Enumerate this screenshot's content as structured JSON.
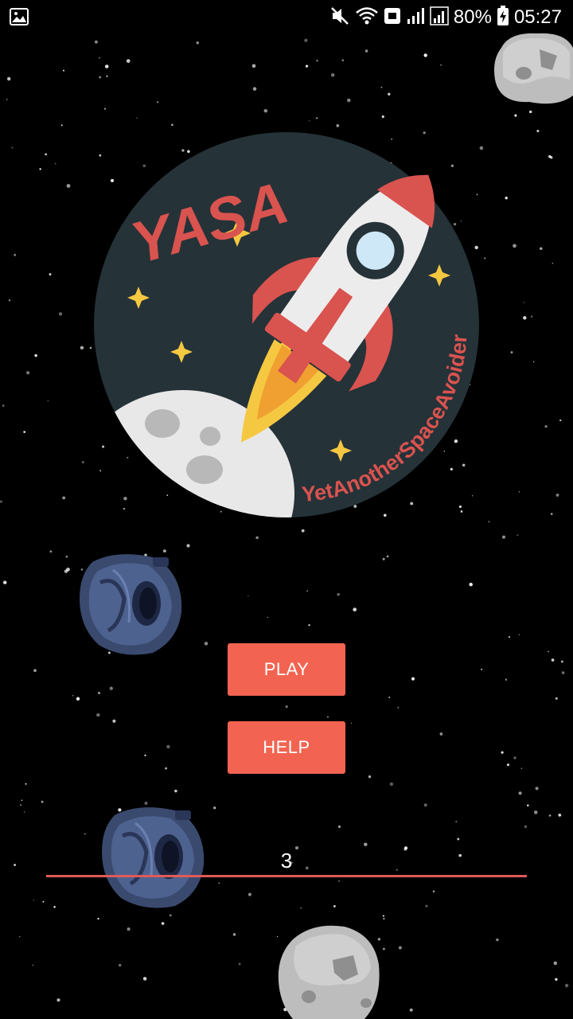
{
  "status_bar": {
    "battery_percent": "80%",
    "time": "05:27",
    "icons": [
      "gallery-icon",
      "mute-icon",
      "wifi-icon",
      "message-icon",
      "signal-icon",
      "signal-icon",
      "battery-charging-icon"
    ]
  },
  "logo": {
    "title": "YASA",
    "subtitle": "YetAnotherSpaceAvoider"
  },
  "menu": {
    "play_label": "PLAY",
    "help_label": "HELP"
  },
  "level_input": {
    "value": "3"
  },
  "colors": {
    "background": "#000000",
    "accent": "#f26451",
    "logo_circle": "#253238",
    "logo_text": "#d9534f",
    "moon": "#e6e6e6",
    "star_yellow": "#f5c842"
  }
}
